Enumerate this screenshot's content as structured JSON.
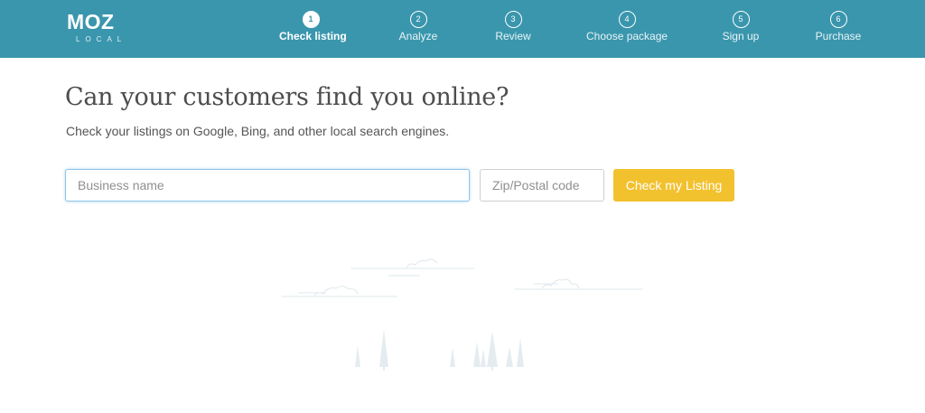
{
  "brand": {
    "name": "MOZ",
    "sub": "LOCAL"
  },
  "steps": [
    {
      "number": "1",
      "label": "Check listing",
      "active": true
    },
    {
      "number": "2",
      "label": "Analyze",
      "active": false
    },
    {
      "number": "3",
      "label": "Review",
      "active": false
    },
    {
      "number": "4",
      "label": "Choose package",
      "active": false
    },
    {
      "number": "5",
      "label": "Sign up",
      "active": false
    },
    {
      "number": "6",
      "label": "Purchase",
      "active": false
    }
  ],
  "hero": {
    "title": "Can your customers find you online?",
    "subtitle": "Check your listings on Google, Bing, and other local search engines."
  },
  "form": {
    "business_placeholder": "Business name",
    "business_value": "",
    "zip_placeholder": "Zip/Postal code",
    "zip_value": "",
    "submit_label": "Check my Listing"
  },
  "colors": {
    "header": "#3a96ad",
    "accent": "#f2c12e",
    "focus_border": "#8cc6e7"
  },
  "illustration": {
    "icons": [
      "cloud-icon",
      "tree-icon"
    ]
  }
}
